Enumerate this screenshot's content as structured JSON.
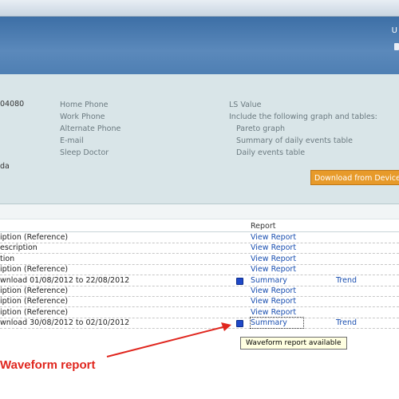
{
  "header": {
    "user_initial": "U"
  },
  "patient": {
    "id_fragment": "04080",
    "city_fragment": "da",
    "contact_labels": [
      "Home Phone",
      "Work Phone",
      "Alternate Phone",
      "E-mail",
      "Sleep Doctor"
    ]
  },
  "report_options": {
    "title": "LS Value",
    "include_label": "Include the following graph and tables:",
    "items": [
      "Pareto graph",
      "Summary of daily events table",
      "Daily events table"
    ]
  },
  "download_button_label": "Download from Device",
  "table": {
    "report_header": "Report",
    "rows": [
      {
        "desc": "iption (Reference)",
        "report": "View Report",
        "trend": "",
        "has_wave_icon": false
      },
      {
        "desc": "escription",
        "report": "View Report",
        "trend": "",
        "has_wave_icon": false
      },
      {
        "desc": "tion",
        "report": "View Report",
        "trend": "",
        "has_wave_icon": false
      },
      {
        "desc": "iption (Reference)",
        "report": "View Report",
        "trend": "",
        "has_wave_icon": false
      },
      {
        "desc": "wnload 01/08/2012 to 22/08/2012",
        "report": "Summary",
        "trend": "Trend",
        "has_wave_icon": true
      },
      {
        "desc": "iption (Reference)",
        "report": "View Report",
        "trend": "",
        "has_wave_icon": false
      },
      {
        "desc": "iption (Reference)",
        "report": "View Report",
        "trend": "",
        "has_wave_icon": false
      },
      {
        "desc": "iption (Reference)",
        "report": "View Report",
        "trend": "",
        "has_wave_icon": false
      },
      {
        "desc": "wnload 30/08/2012 to 02/10/2012",
        "report": "Summary",
        "trend": "Trend",
        "has_wave_icon": true
      }
    ]
  },
  "tooltip_text": "Waveform report available",
  "annotation_text": "Waveform report",
  "colors": {
    "header": "#4f7fb3",
    "panel": "#d9e5e8",
    "button": "#e79a2a",
    "link": "#1a4fb0",
    "annotation": "#e0261e"
  }
}
